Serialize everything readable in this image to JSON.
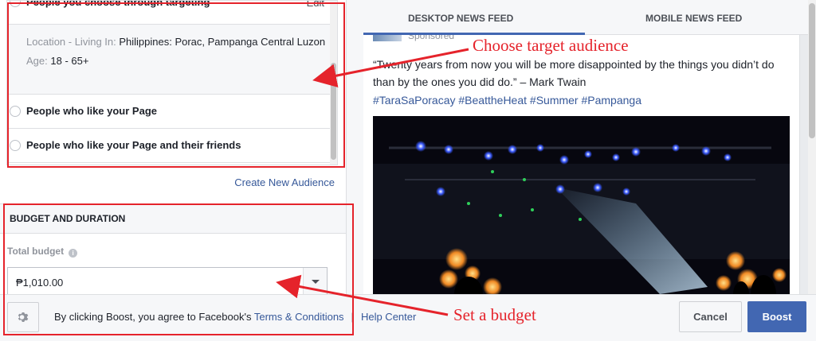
{
  "audience": {
    "targeting_label": "People you choose through targeting",
    "edit_label": "Edit",
    "location_key": "Location - Living In:",
    "location_value": "Philippines: Porac, Pampanga Central Luzon",
    "age_key": "Age:",
    "age_value": "18 - 65+",
    "options": [
      "People who like your Page",
      "People who like your Page and their friends"
    ],
    "create_new": "Create New Audience"
  },
  "budget": {
    "section_title": "BUDGET AND DURATION",
    "total_label": "Total budget",
    "info_icon": "i",
    "value": "₱1,010.00"
  },
  "preview": {
    "tabs": [
      "DESKTOP NEWS FEED",
      "MOBILE NEWS FEED"
    ],
    "active_tab": "DESKTOP NEWS FEED",
    "sponsored": "Sponsored",
    "caption": "“Twenty years from now you will be more disappointed by the things you didn’t do than by the ones you did do.” – Mark Twain",
    "hashtags": "#TaraSaPoracay #BeattheHeat #Summer #Pampanga"
  },
  "footer": {
    "agree_text": "By clicking Boost, you agree to Facebook's",
    "terms_link": "Terms & Conditions",
    "separator": "|",
    "help_link": "Help Center",
    "cancel_label": "Cancel",
    "boost_label": "Boost"
  },
  "annotations": {
    "target_note": "Choose target audience",
    "budget_note": "Set a budget"
  },
  "colors": {
    "accent": "#4267b2",
    "link": "#365899",
    "annotation": "#e5232b"
  }
}
